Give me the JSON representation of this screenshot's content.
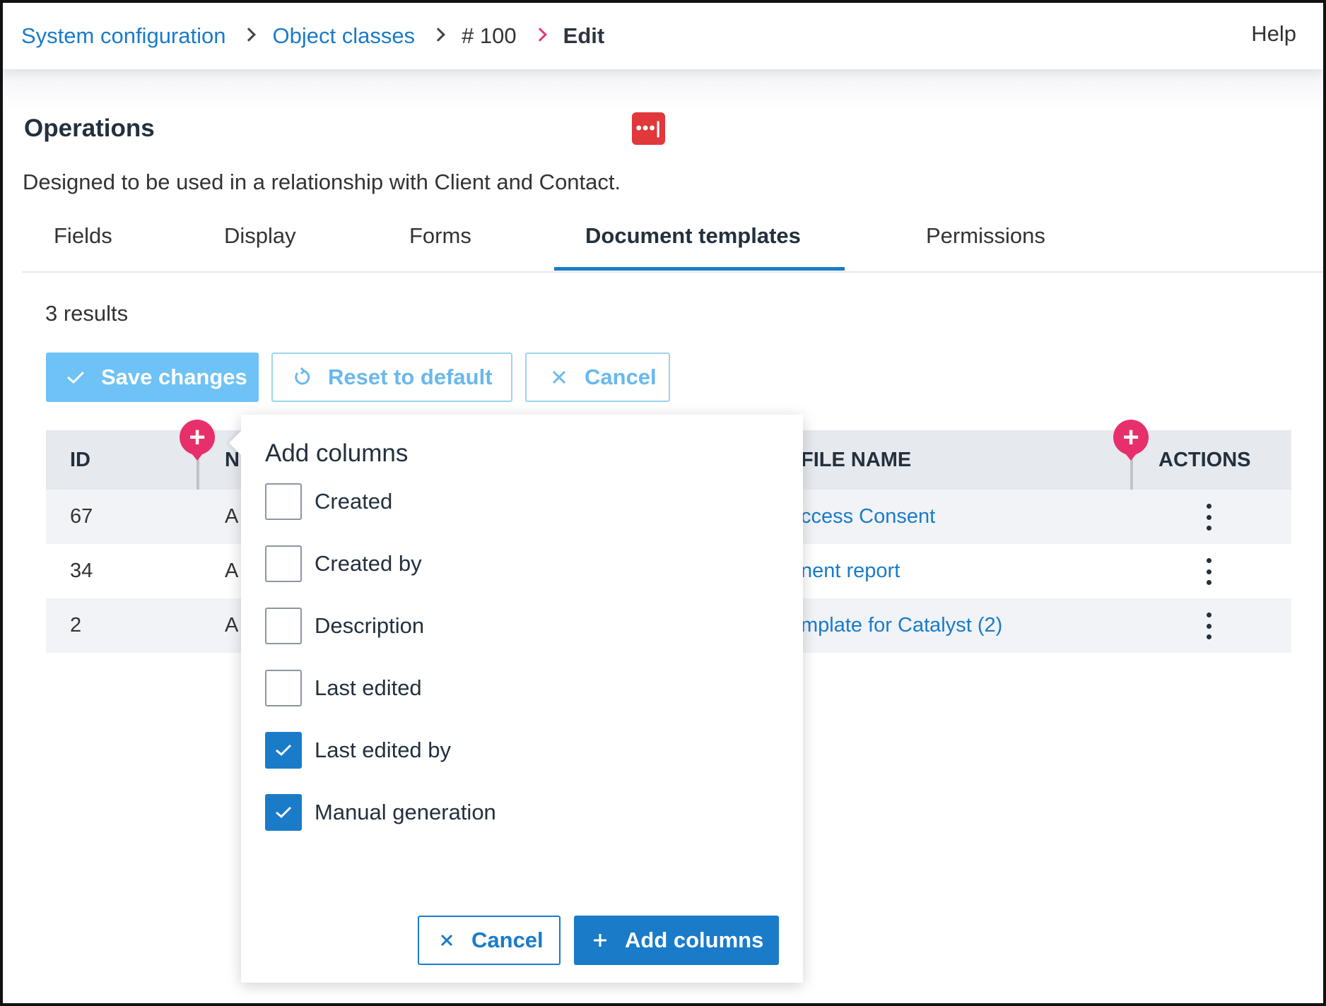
{
  "breadcrumb": {
    "items": [
      "System configuration",
      "Object classes",
      "# 100"
    ],
    "current": "Edit"
  },
  "header": {
    "help_label": "Help"
  },
  "page": {
    "title": "Operations",
    "description": "Designed to be used in a relationship with Client and Contact.",
    "title_icon_label": "•••|"
  },
  "tabs": [
    {
      "label": "Fields"
    },
    {
      "label": "Display"
    },
    {
      "label": "Forms"
    },
    {
      "label": "Document templates",
      "active": true
    },
    {
      "label": "Permissions"
    }
  ],
  "results_label": "3 results",
  "toolbar": {
    "save_label": "Save changes",
    "reset_label": "Reset to default",
    "cancel_label": "Cancel"
  },
  "table": {
    "headers": {
      "id": "ID",
      "name": "N",
      "file_name": "FILE NAME",
      "actions": "ACTIONS"
    },
    "rows": [
      {
        "id": "67",
        "name": "A",
        "file_name": "ccess Consent"
      },
      {
        "id": "34",
        "name": "A",
        "file_name": "nent report"
      },
      {
        "id": "2",
        "name": "A",
        "file_name": "mplate for Catalyst (2)"
      }
    ]
  },
  "add_columns_popover": {
    "title": "Add columns",
    "options": [
      {
        "label": "Created",
        "checked": false
      },
      {
        "label": "Created by",
        "checked": false
      },
      {
        "label": "Description",
        "checked": false
      },
      {
        "label": "Last edited",
        "checked": false
      },
      {
        "label": "Last edited by",
        "checked": true
      },
      {
        "label": "Manual generation",
        "checked": true
      }
    ],
    "cancel_label": "Cancel",
    "add_label": "Add columns"
  },
  "colors": {
    "link": "#1a7bc9",
    "primary": "#1a7bc9",
    "primary_light": "#6ec2f5",
    "pin": "#e7306b",
    "title_icon": "#e0383b"
  }
}
